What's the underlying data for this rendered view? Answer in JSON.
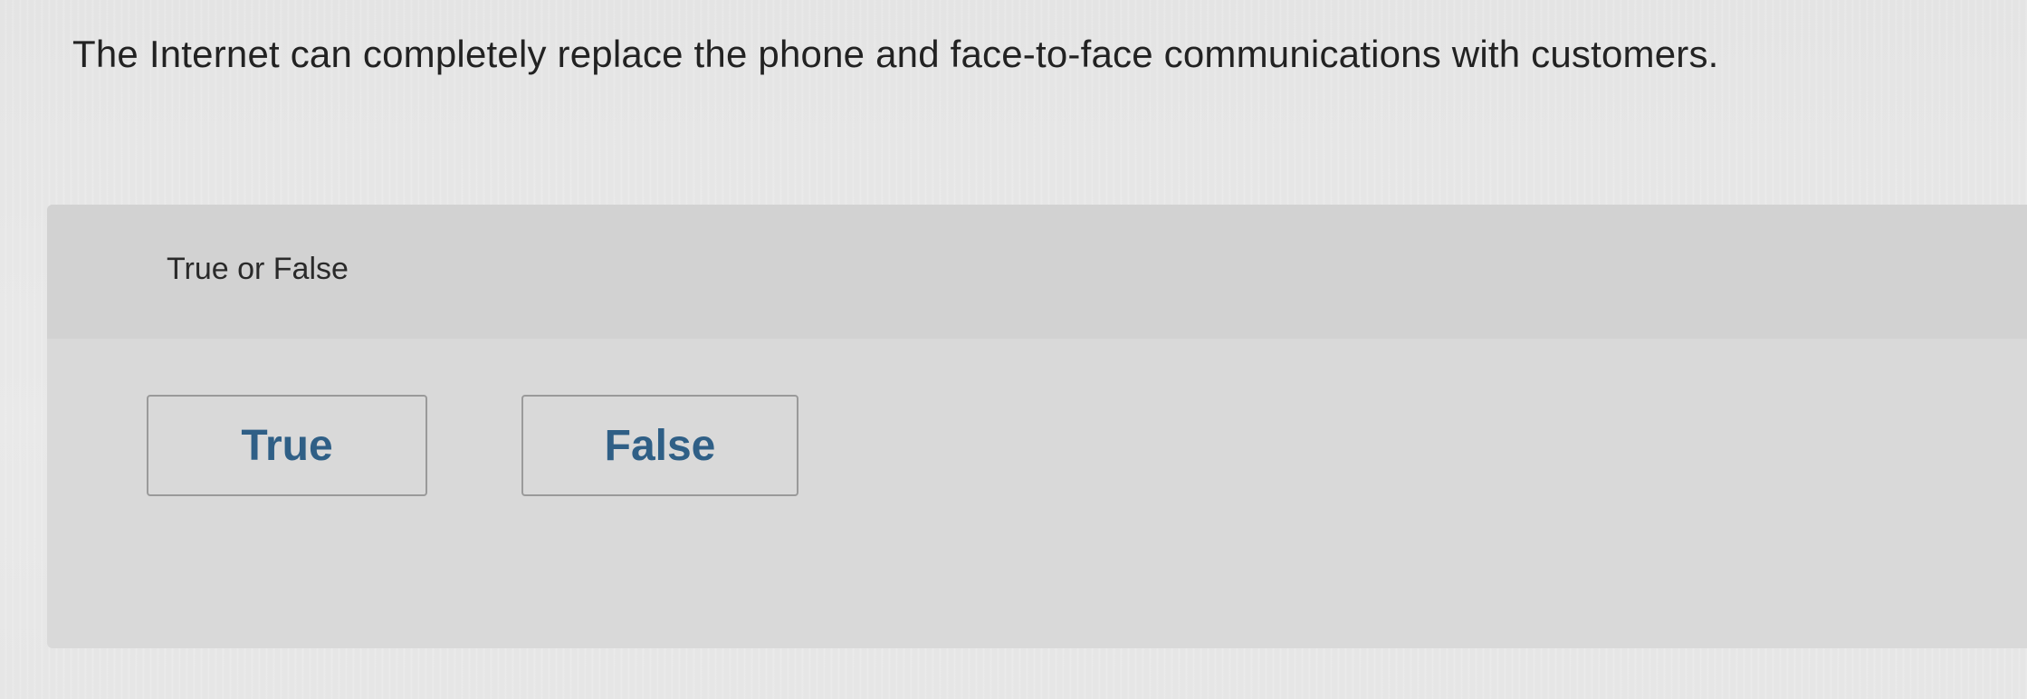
{
  "question": {
    "text": "The Internet can completely replace the phone and face-to-face communications with customers."
  },
  "answer_area": {
    "instruction": "True or False",
    "choices": [
      {
        "label": "True"
      },
      {
        "label": "False"
      }
    ]
  },
  "colors": {
    "choice_text": "#2f5f86",
    "panel_background": "#d9d9d9"
  }
}
